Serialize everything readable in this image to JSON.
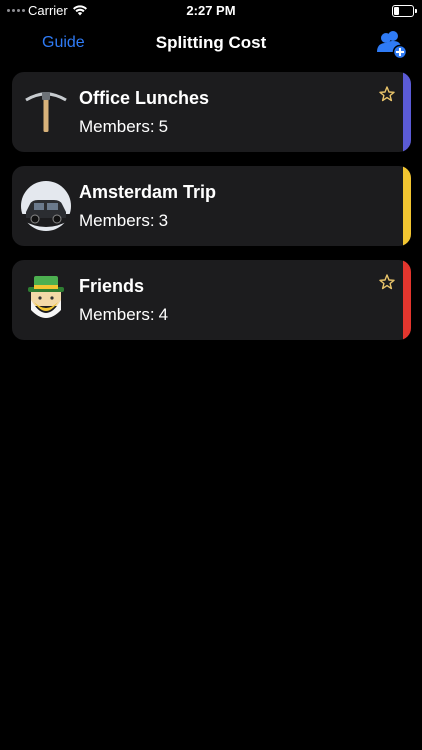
{
  "status_bar": {
    "carrier": "Carrier",
    "time": "2:27 PM"
  },
  "nav": {
    "left_label": "Guide",
    "title": "Splitting Cost",
    "right_icon": "add-group-icon",
    "accent": "#2f7bf5"
  },
  "groups": [
    {
      "name": "Office Lunches",
      "members_label": "Members:",
      "members": "5",
      "icon": "pickaxe-icon",
      "color": "#5b5bd6",
      "starred": true
    },
    {
      "name": "Amsterdam Trip",
      "members_label": "Members:",
      "members": "3",
      "icon": "taxi-moon-icon",
      "color": "#f2c531",
      "starred": false
    },
    {
      "name": "Friends",
      "members_label": "Members:",
      "members": "4",
      "icon": "leprechaun-icon",
      "color": "#e3362e",
      "starred": true
    }
  ]
}
